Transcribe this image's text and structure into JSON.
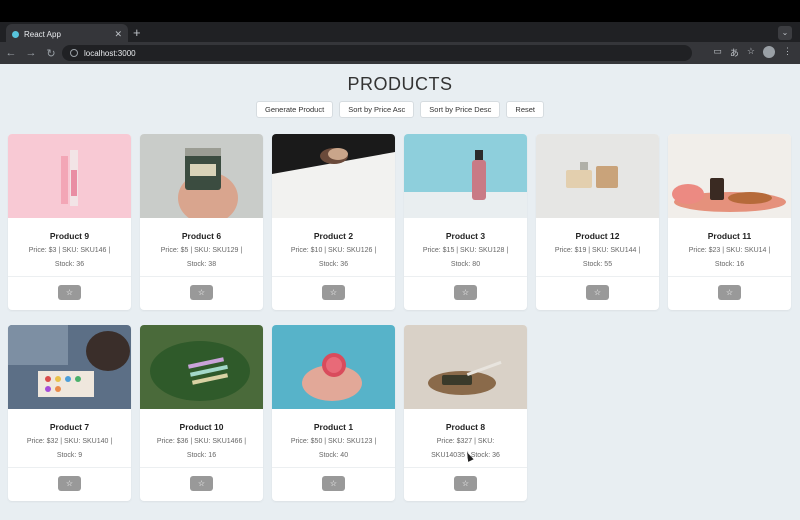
{
  "browser": {
    "tab_title": "React App",
    "tab_close": "✕",
    "new_tab": "+",
    "url": "localhost:3000",
    "nav": {
      "back": "←",
      "forward": "→",
      "reload": "↻"
    },
    "toolbar_icons": [
      "cast-icon",
      "translate-icon",
      "star-icon"
    ]
  },
  "page": {
    "title": "PRODUCTS",
    "buttons": {
      "generate": "Generate Product",
      "sort_asc": "Sort by Price Asc",
      "sort_desc": "Sort by Price Desc",
      "reset": "Reset"
    }
  },
  "products": [
    {
      "name": "Product 9",
      "meta_line1": "Price: $3 | SKU: SKU146 |",
      "meta_line2": "Stock: 36",
      "button": "☆"
    },
    {
      "name": "Product 6",
      "meta_line1": "Price: $5 | SKU: SKU129 |",
      "meta_line2": "Stock: 38",
      "button": "☆"
    },
    {
      "name": "Product 2",
      "meta_line1": "Price: $10 | SKU: SKU126 |",
      "meta_line2": "Stock: 36",
      "button": "☆"
    },
    {
      "name": "Product 3",
      "meta_line1": "Price: $15 | SKU: SKU128 |",
      "meta_line2": "Stock: 80",
      "button": "☆"
    },
    {
      "name": "Product 12",
      "meta_line1": "Price: $19 | SKU: SKU144 |",
      "meta_line2": "Stock: 55",
      "button": "☆"
    },
    {
      "name": "Product 11",
      "meta_line1": "Price: $23 | SKU: SKU14 |",
      "meta_line2": "Stock: 16",
      "button": "☆"
    },
    {
      "name": "Product 7",
      "meta_line1": "Price: $32 | SKU: SKU140 |",
      "meta_line2": "Stock: 9",
      "button": "☆"
    },
    {
      "name": "Product 10",
      "meta_line1": "Price: $36 | SKU: SKU1466 |",
      "meta_line2": "Stock: 16",
      "button": "☆"
    },
    {
      "name": "Product 1",
      "meta_line1": "Price: $50 | SKU: SKU123 |",
      "meta_line2": "Stock: 40",
      "button": "☆"
    },
    {
      "name": "Product 8",
      "meta_line1": "Price: $327 | SKU:",
      "meta_line2": "SKU14035 | Stock: 36",
      "button": "☆"
    }
  ]
}
